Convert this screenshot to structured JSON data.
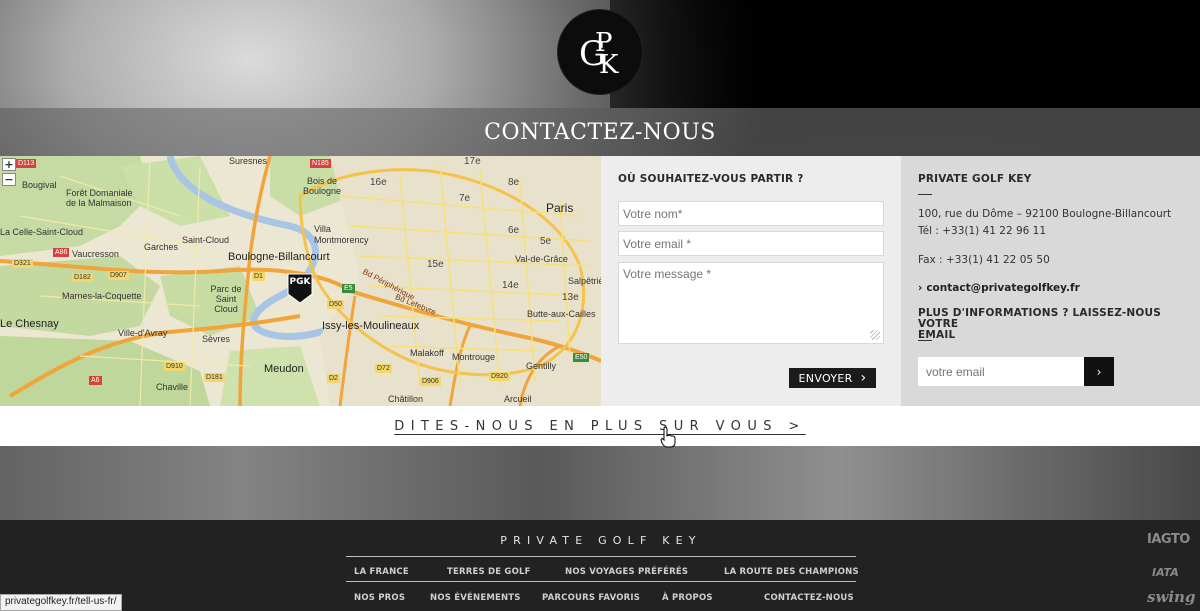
{
  "logo": {
    "letters": "PGK"
  },
  "header": {
    "title": "CONTACTEZ-NOUS"
  },
  "map": {
    "zoom_in": "+",
    "zoom_out": "−",
    "pin_label": "PGK",
    "labels": [
      "Suresnes",
      "Bois de Boulogne",
      "Bougival",
      "Forêt Domaniale de la Malmaison",
      "Villa Montmorency",
      "16e",
      "17e",
      "8e",
      "Paris",
      "7e",
      "6e",
      "5e",
      "Val-de-Grâce",
      "La Celle-Saint-Cloud",
      "Vaucresson",
      "Garches",
      "Saint-Cloud",
      "Boulogne-Billancourt",
      "15e",
      "14e",
      "13e",
      "Salpêtrière",
      "Marnes-la-Coquette",
      "Parc de Saint Cloud",
      "Bd Périphérique",
      "Bd Lefebvre",
      "Butte-aux-Cailles",
      "Le Chesnay",
      "Ville-d'Avray",
      "Sèvres",
      "Issy-les-Moulineaux",
      "Malakoff",
      "Montrouge",
      "Gentilly",
      "Chaville",
      "Meudon",
      "Châtillon",
      "Arcueil"
    ],
    "roads": [
      "D113",
      "N185",
      "A86",
      "D321",
      "D182",
      "D907",
      "D1",
      "D910",
      "D181",
      "D2",
      "D72",
      "D906",
      "D920",
      "E5",
      "D50",
      "E50",
      "A6"
    ]
  },
  "form": {
    "heading": "OÙ SOUHAITEZ-VOUS PARTIR ?",
    "name_placeholder": "Votre nom*",
    "email_placeholder": "Votre email *",
    "message_placeholder": "Votre message *",
    "submit_label": "ENVOYER",
    "submit_icon": "›"
  },
  "company": {
    "name": "PRIVATE GOLF KEY",
    "address": "100, rue du Dôme – 92100 Boulogne-Billancourt",
    "phone": "Tél : +33(1) 41 22 96 11",
    "fax": "Fax : +33(1) 41 22 05 50",
    "email_link": "contact@privategolfkey.fr",
    "email_arrow": "›"
  },
  "newsletter": {
    "heading_line1": "PLUS D'INFORMATIONS ? LAISSEZ-NOUS VOTRE",
    "heading_line2": "EMAIL",
    "placeholder": "votre email",
    "button_icon": "›"
  },
  "tell_us": {
    "label": "DITES-NOUS EN PLUS SUR VOUS >"
  },
  "footer": {
    "title": "PRIVATE GOLF KEY",
    "nav_row1": [
      "LA FRANCE",
      "TERRES DE GOLF",
      "NOS VOYAGES PRÉFÉRÉS",
      "LA ROUTE DES CHAMPIONS"
    ],
    "nav_row2": [
      "NOS PROS",
      "NOS ÉVÉNEMENTS",
      "PARCOURS FAVORIS",
      "À PROPOS",
      "CONTACTEZ-NOUS"
    ],
    "partners": [
      "IAGTO",
      "IATA",
      "swing"
    ]
  },
  "status_bar": {
    "url": "privategolfkey.fr/tell-us-fr/"
  }
}
